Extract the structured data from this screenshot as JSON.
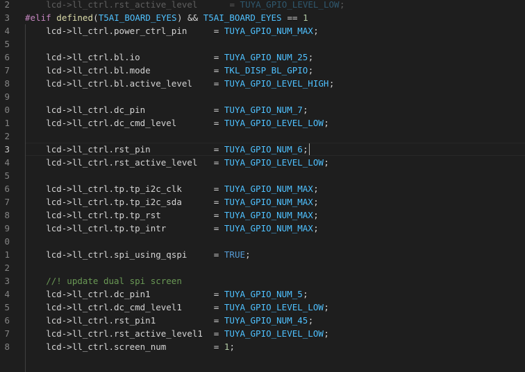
{
  "editor": {
    "lines": [
      {
        "n": "2",
        "code": "    lcd->ll_ctrl.rst_active_level      = TUYA_GPIO_LEVEL_LOW;",
        "kind": "faded"
      },
      {
        "n": "3",
        "code": "#elif defined(T5AI_BOARD_EYES) && T5AI_BOARD_EYES == 1",
        "kind": "elif"
      },
      {
        "n": "4",
        "code": "    lcd->ll_ctrl.power_ctrl_pin     = TUYA_GPIO_NUM_MAX;",
        "kind": "assign"
      },
      {
        "n": "5",
        "code": "",
        "kind": "blank"
      },
      {
        "n": "6",
        "code": "    lcd->ll_ctrl.bl.io              = TUYA_GPIO_NUM_25;",
        "kind": "assign"
      },
      {
        "n": "7",
        "code": "    lcd->ll_ctrl.bl.mode            = TKL_DISP_BL_GPIO;",
        "kind": "assign"
      },
      {
        "n": "8",
        "code": "    lcd->ll_ctrl.bl.active_level    = TUYA_GPIO_LEVEL_HIGH;",
        "kind": "assign"
      },
      {
        "n": "9",
        "code": "",
        "kind": "blank"
      },
      {
        "n": "0",
        "code": "    lcd->ll_ctrl.dc_pin             = TUYA_GPIO_NUM_7;",
        "kind": "assign"
      },
      {
        "n": "1",
        "code": "    lcd->ll_ctrl.dc_cmd_level       = TUYA_GPIO_LEVEL_LOW;",
        "kind": "assign"
      },
      {
        "n": "2",
        "code": "",
        "kind": "blank"
      },
      {
        "n": "3",
        "code": "    lcd->ll_ctrl.rst_pin            = TUYA_GPIO_NUM_6;",
        "kind": "assign",
        "current": true
      },
      {
        "n": "4",
        "code": "    lcd->ll_ctrl.rst_active_level   = TUYA_GPIO_LEVEL_LOW;",
        "kind": "assign"
      },
      {
        "n": "5",
        "code": "",
        "kind": "blank"
      },
      {
        "n": "6",
        "code": "    lcd->ll_ctrl.tp.tp_i2c_clk      = TUYA_GPIO_NUM_MAX;",
        "kind": "assign"
      },
      {
        "n": "7",
        "code": "    lcd->ll_ctrl.tp.tp_i2c_sda      = TUYA_GPIO_NUM_MAX;",
        "kind": "assign"
      },
      {
        "n": "8",
        "code": "    lcd->ll_ctrl.tp.tp_rst          = TUYA_GPIO_NUM_MAX;",
        "kind": "assign"
      },
      {
        "n": "9",
        "code": "    lcd->ll_ctrl.tp.tp_intr         = TUYA_GPIO_NUM_MAX;",
        "kind": "assign"
      },
      {
        "n": "0",
        "code": "",
        "kind": "blank"
      },
      {
        "n": "1",
        "code": "    lcd->ll_ctrl.spi_using_qspi     = TRUE;",
        "kind": "assign"
      },
      {
        "n": "2",
        "code": "",
        "kind": "blank"
      },
      {
        "n": "3",
        "code": "    //! update dual spi screen",
        "kind": "comment"
      },
      {
        "n": "4",
        "code": "    lcd->ll_ctrl.dc_pin1            = TUYA_GPIO_NUM_5;",
        "kind": "assign"
      },
      {
        "n": "5",
        "code": "    lcd->ll_ctrl.dc_cmd_level1      = TUYA_GPIO_LEVEL_LOW;",
        "kind": "assign"
      },
      {
        "n": "6",
        "code": "    lcd->ll_ctrl.rst_pin1           = TUYA_GPIO_NUM_45;",
        "kind": "assign"
      },
      {
        "n": "7",
        "code": "    lcd->ll_ctrl.rst_active_level1  = TUYA_GPIO_LEVEL_LOW;",
        "kind": "assign"
      },
      {
        "n": "8",
        "code": "    lcd->ll_ctrl.screen_num         = 1;",
        "kind": "assign"
      }
    ]
  },
  "colors": {
    "background": "#1e1e1e",
    "keyword": "#c586c0",
    "function": "#dcdcaa",
    "macro": "#4fc1ff",
    "text": "#d4d4d4",
    "number": "#b5cea8",
    "comment": "#6a9955",
    "constant": "#569cd6"
  }
}
